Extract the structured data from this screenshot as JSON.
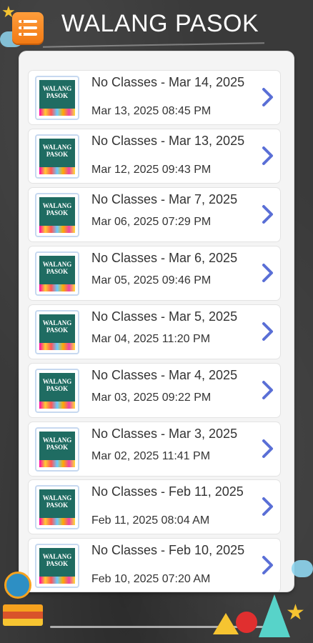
{
  "header": {
    "title": "WALANG PASOK",
    "menu_icon": "menu-list-icon"
  },
  "thumb_label": "WALANG PASOK",
  "items": [
    {
      "title": "No Classes - Mar 14, 2025",
      "date": "Mar 13, 2025 08:45 PM"
    },
    {
      "title": "No Classes - Mar 13, 2025",
      "date": "Mar 12, 2025 09:43 PM"
    },
    {
      "title": "No Classes - Mar 7, 2025",
      "date": "Mar 06, 2025 07:29 PM"
    },
    {
      "title": "No Classes - Mar 6, 2025",
      "date": "Mar 05, 2025 09:46 PM"
    },
    {
      "title": "No Classes - Mar 5, 2025",
      "date": "Mar 04, 2025 11:20 PM"
    },
    {
      "title": "No Classes - Mar 4, 2025",
      "date": "Mar 03, 2025 09:22 PM"
    },
    {
      "title": "No Classes - Mar 3, 2025",
      "date": "Mar 02, 2025 11:41 PM"
    },
    {
      "title": "No Classes - Feb 11, 2025",
      "date": "Feb 11, 2025 08:04 AM"
    },
    {
      "title": "No Classes - Feb 10, 2025",
      "date": "Feb 10, 2025 07:20 AM"
    }
  ],
  "colors": {
    "chevron": "#5a6fd6",
    "menu_button": "#f58a1f",
    "thumb_bg": "#1f6c62"
  }
}
